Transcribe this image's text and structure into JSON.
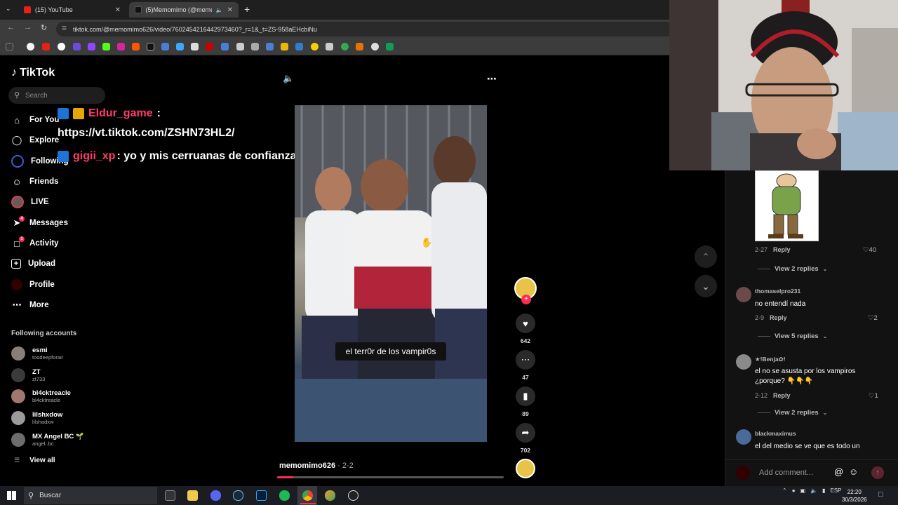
{
  "browser": {
    "tabs": [
      {
        "title": "(15) YouTube",
        "active": false
      },
      {
        "title": "(5)Memomimo (@memomi",
        "active": true
      }
    ],
    "url": "tiktok.com/@memomimo626/video/7602454216442973460?_r=1&_t=ZS-958aEHcbiNu"
  },
  "sidebar": {
    "logo": "TikTok",
    "search_placeholder": "Search",
    "nav": [
      {
        "label": "For You",
        "icon": "home-icon"
      },
      {
        "label": "Explore",
        "icon": "compass-icon"
      },
      {
        "label": "Following",
        "icon": "following-icon"
      },
      {
        "label": "Friends",
        "icon": "friends-icon"
      },
      {
        "label": "LIVE",
        "icon": "live-icon"
      },
      {
        "label": "Messages",
        "icon": "messages-icon",
        "badge": "4"
      },
      {
        "label": "Activity",
        "icon": "activity-icon",
        "badge": "1"
      },
      {
        "label": "Upload",
        "icon": "upload-icon"
      },
      {
        "label": "Profile",
        "icon": "profile-icon"
      },
      {
        "label": "More",
        "icon": "more-icon"
      }
    ],
    "following_title": "Following accounts",
    "accounts": [
      {
        "name": "esmi",
        "handle": "toodeepforair"
      },
      {
        "name": "ZT",
        "handle": "zt733"
      },
      {
        "name": "bl4cktreacle",
        "handle": "bl4cktreacle"
      },
      {
        "name": "lilshxdow",
        "handle": "lilshadxw"
      },
      {
        "name": "MX Angel BC 🌱",
        "handle": "angel..bc"
      }
    ],
    "view_all": "View all"
  },
  "chat": [
    {
      "user": "Eldur_game",
      "message": ":"
    },
    {
      "user": "",
      "message": "https://vt.tiktok.com/ZSHN73HL2/"
    },
    {
      "user": "gigii_xp",
      "message": ": yo y mis cerruanas de confianza"
    }
  ],
  "video": {
    "caption": "el terr0r de los vampir0s",
    "author": "memomimo626",
    "date": " · 2-2",
    "progress": 0.07
  },
  "actions": {
    "likes": "642",
    "comments": "47",
    "saves": "89",
    "shares": "702"
  },
  "comments": [
    {
      "user": "",
      "text": "",
      "date": "2-27",
      "reply": "Reply",
      "likes": "40",
      "view_replies": "View 2 replies"
    },
    {
      "user": "thomaselpro231",
      "text": "no entendí nada",
      "date": "2-9",
      "reply": "Reply",
      "likes": "2",
      "view_replies": "View 5 replies"
    },
    {
      "user": "★!Benja✿!",
      "text": "el no se asusta por los vampiros ¿porque? 👇👇👇",
      "date": "2-12",
      "reply": "Reply",
      "likes": "1",
      "view_replies": "View 2 replies"
    },
    {
      "user": "blackmaximus",
      "text": "el del medio se ve que es todo un",
      "date": "",
      "reply": "",
      "likes": "",
      "view_replies": ""
    }
  ],
  "comment_box_placeholder": "Add comment...",
  "taskbar": {
    "search": "Buscar",
    "lang": "ESP",
    "time": "22:20",
    "date": "30/3/2026"
  },
  "colors": {
    "accent": "#fe2c55",
    "background": "#000000",
    "chat_user": "#ff3d6a"
  }
}
